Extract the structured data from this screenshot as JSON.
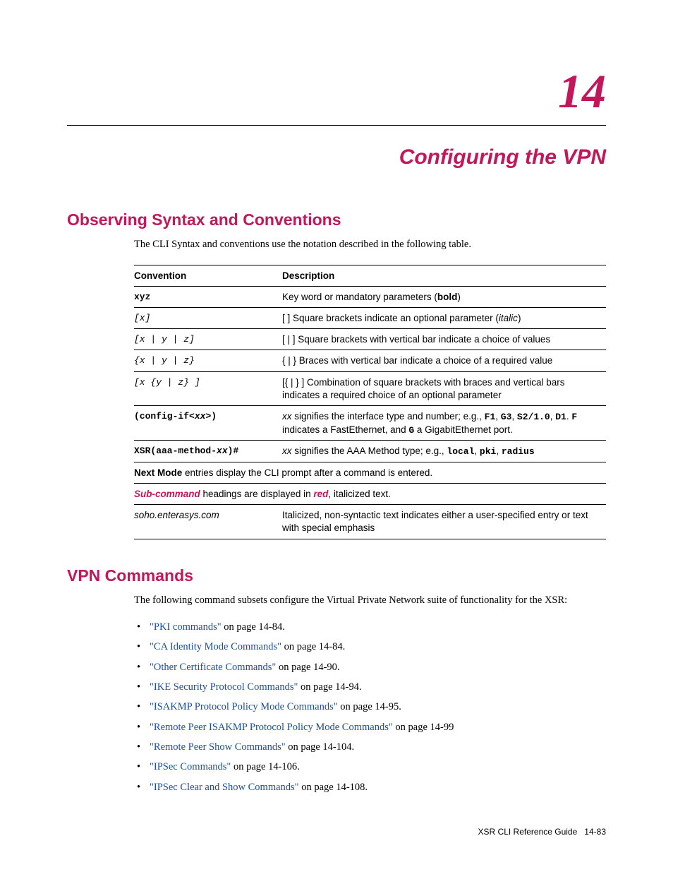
{
  "chapter_number": "14",
  "chapter_title": "Configuring the VPN",
  "section1": {
    "heading": "Observing Syntax and Conventions",
    "intro": "The CLI Syntax and conventions use the notation described in the following table.",
    "table_headers": {
      "c1": "Convention",
      "c2": "Description"
    },
    "rows": {
      "r1c1": "xyz",
      "r1c2a": "Key word or mandatory parameters (",
      "r1c2b": "bold",
      "r1c2c": ")",
      "r2c1": "[x]",
      "r2c2a": "[ ] Square brackets indicate an optional parameter (",
      "r2c2b": "italic",
      "r2c2c": ")",
      "r3c1": "[x | y | z]",
      "r3c2": "[ | ] Square brackets with vertical bar indicate a choice of values",
      "r4c1": "{x | y | z}",
      "r4c2": "{ | } Braces with vertical bar indicate a choice of a required value",
      "r5c1": "[x {y | z} ]",
      "r5c2": "[{ | } ] Combination of square brackets with braces and vertical bars indicates a required choice of an optional parameter",
      "r6c1a": "(config-if<",
      "r6c1b": "xx",
      "r6c1c": ">)",
      "r6c2a": "xx",
      "r6c2b": " signifies the interface type and number; e.g., ",
      "r6c2c": "F1",
      "r6c2d": ", ",
      "r6c2e": "G3",
      "r6c2f": ", ",
      "r6c2g": "S2/1.0",
      "r6c2h": ", ",
      "r6c2i": "D1",
      "r6c2j": ". ",
      "r6c2k": "F",
      "r6c2l": " indicates a FastEthernet, and ",
      "r6c2m": "G",
      "r6c2n": " a GigabitEthernet port.",
      "r7c1a": "XSR(aaa-method-",
      "r7c1b": "xx",
      "r7c1c": ")#",
      "r7c2a": "xx",
      "r7c2b": " signifies the AAA Method type; e.g., ",
      "r7c2c": "local",
      "r7c2d": ", ",
      "r7c2e": "pki",
      "r7c2f": ", ",
      "r7c2g": "radius",
      "r8a": "Next Mode",
      "r8b": " entries display the CLI prompt after a command is entered.",
      "r9a": "Sub-command",
      "r9b": " headings are displayed in ",
      "r9c": "red",
      "r9d": ", italicized text.",
      "r10c1": "soho.enterasys.com",
      "r10c2": "Italicized, non-syntactic text indicates either a user-specified entry or text with special emphasis"
    }
  },
  "section2": {
    "heading": "VPN Commands",
    "intro": "The following command subsets configure the Virtual Private Network suite of functionality for the XSR:",
    "items": [
      {
        "link": "\"PKI commands\"",
        "rest": " on page 14-84."
      },
      {
        "link": "\"CA Identity Mode Commands\"",
        "rest": " on page 14-84."
      },
      {
        "link": "\"Other Certificate Commands\"",
        "rest": " on page 14-90."
      },
      {
        "link": "\"IKE Security Protocol Commands\"",
        "rest": " on page 14-94."
      },
      {
        "link": "\"ISAKMP Protocol Policy Mode Commands\"",
        "rest": " on page 14-95."
      },
      {
        "link": "\"Remote Peer ISAKMP Protocol Policy Mode Commands\"",
        "rest": " on page 14-99"
      },
      {
        "link": "\"Remote Peer Show Commands\"",
        "rest": " on page 14-104."
      },
      {
        "link": "\"IPSec Commands\"",
        "rest": " on page 14-106."
      },
      {
        "link": "\"IPSec Clear and Show Commands\"",
        "rest": " on page 14-108."
      }
    ]
  },
  "footer": {
    "guide": "XSR CLI Reference Guide",
    "page": "14-83"
  }
}
